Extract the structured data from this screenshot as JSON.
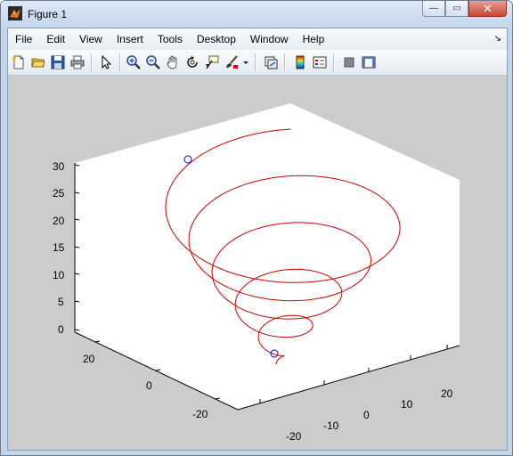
{
  "window": {
    "title": "Figure 1",
    "minimize_glyph": "—",
    "maximize_glyph": "▭",
    "close_glyph": "✕"
  },
  "menu": {
    "items": [
      "File",
      "Edit",
      "View",
      "Insert",
      "Tools",
      "Desktop",
      "Window",
      "Help"
    ],
    "dock_arrow": "↘"
  },
  "toolbar": {
    "buttons": [
      "new-figure",
      "open-file",
      "save",
      "print",
      "edit-plot",
      "zoom-in",
      "zoom-out",
      "pan",
      "rotate-3d",
      "data-cursor",
      "brush",
      "brush-dropdown",
      "link-plot",
      "insert-colorbar",
      "insert-legend",
      "hide-plot-tools",
      "show-plot-tools"
    ]
  },
  "colors": {
    "plot_line": "#cc0000",
    "marker": "#0000cc",
    "figure_bg": "#cccccc",
    "axes_bg": "#ffffff"
  },
  "chart_data": {
    "type": "line",
    "dimensions": 3,
    "series": [
      {
        "description": "conical helix rising from near origin outward",
        "start_marker": {
          "x": 0,
          "y": 0,
          "z": 0
        },
        "end_marker": {
          "x": -10,
          "y": 25,
          "z": 30
        },
        "turns": 5,
        "max_radius": 30
      }
    ],
    "xlim": [
      -25,
      25
    ],
    "ylim": [
      -25,
      25
    ],
    "zlim": [
      0,
      30
    ],
    "x_ticks": [
      "-20",
      "-10",
      "0",
      "10",
      "20"
    ],
    "y_ticks": [
      "-20",
      "0",
      "20"
    ],
    "z_ticks": [
      "0",
      "5",
      "10",
      "15",
      "20",
      "25",
      "30"
    ],
    "grid": false
  }
}
